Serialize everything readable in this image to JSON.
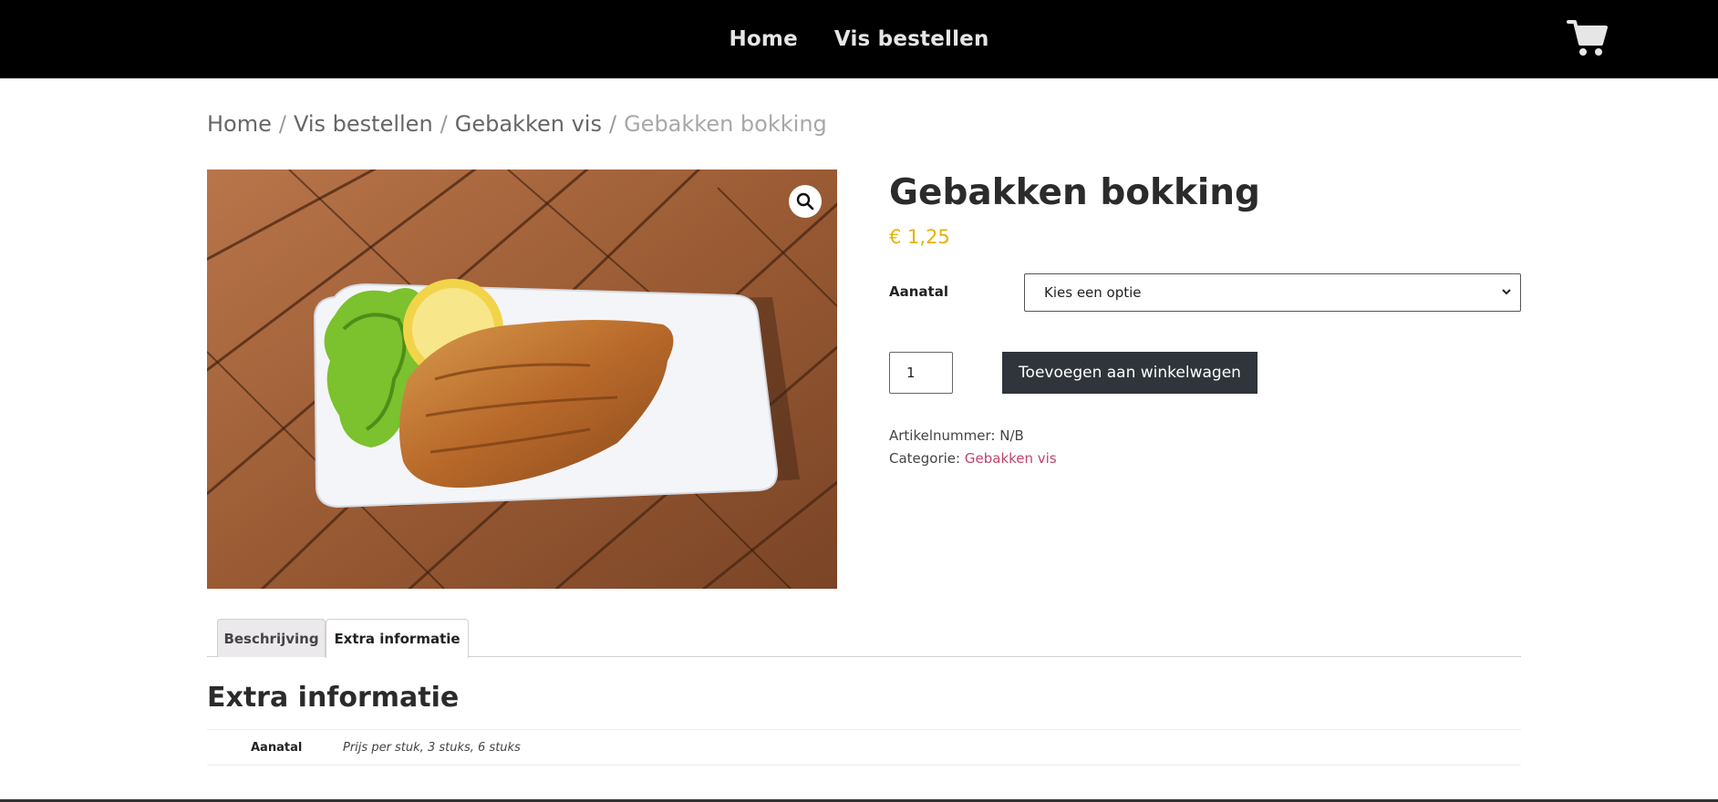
{
  "nav": {
    "home": "Home",
    "order": "Vis bestellen"
  },
  "cart": {
    "icon": "cart-icon"
  },
  "breadcrumb": {
    "items": [
      "Home",
      "Vis bestellen",
      "Gebakken vis"
    ],
    "current": "Gebakken bokking",
    "separator": "/"
  },
  "product": {
    "title": "Gebakken bokking",
    "price": "€ 1,25",
    "variation_label": "Aanatal",
    "select_value": "Kies een optie",
    "quantity": "1",
    "add_to_cart": "Toevoegen aan winkelwagen",
    "sku_label": "Artikelnummer:",
    "sku_value": "N/B",
    "category_label": "Categorie:",
    "category_value": "Gebakken vis"
  },
  "tabs": {
    "description": "Beschrijving",
    "extra": "Extra informatie"
  },
  "extra": {
    "heading": "Extra informatie",
    "rows": [
      {
        "label": "Aanatal",
        "value": "Prijs per stuk, 3 stuks, 6 stuks"
      }
    ]
  },
  "colors": {
    "topbar": "#000000",
    "price": "#e8b100",
    "button": "#2f353a",
    "link": "#c0446a"
  }
}
